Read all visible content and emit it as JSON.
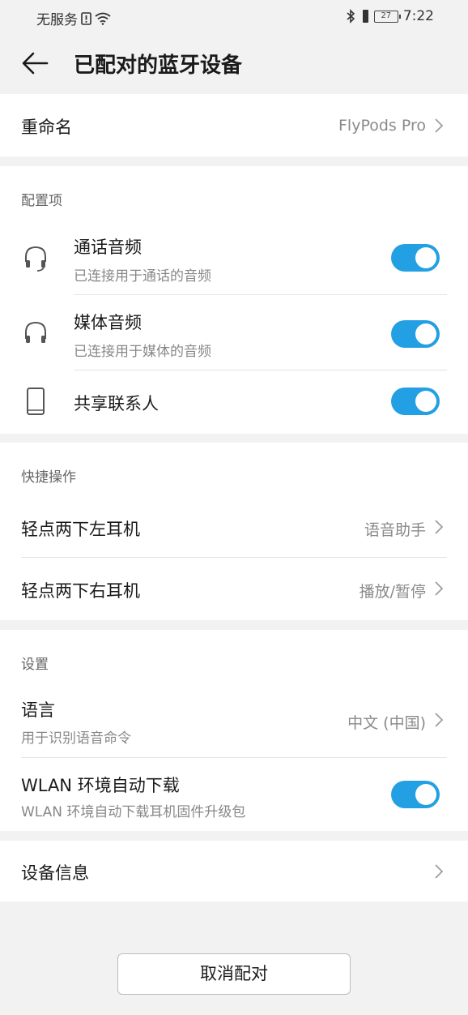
{
  "status_bar": {
    "carrier": "无服务",
    "battery": "27",
    "time": "7:22"
  },
  "header": {
    "title": "已配对的蓝牙设备"
  },
  "rename": {
    "label": "重命名",
    "value": "FlyPods Pro"
  },
  "config": {
    "section_label": "配置项",
    "items": [
      {
        "title": "通话音频",
        "subtitle": "已连接用于通话的音频",
        "enabled": true,
        "icon": "headset-icon"
      },
      {
        "title": "媒体音频",
        "subtitle": "已连接用于媒体的音频",
        "enabled": true,
        "icon": "headphones-icon"
      },
      {
        "title": "共享联系人",
        "enabled": true,
        "icon": "phone-icon"
      }
    ]
  },
  "shortcuts": {
    "section_label": "快捷操作",
    "items": [
      {
        "title": "轻点两下左耳机",
        "value": "语音助手"
      },
      {
        "title": "轻点两下右耳机",
        "value": "播放/暂停"
      }
    ]
  },
  "settings": {
    "section_label": "设置",
    "language": {
      "title": "语言",
      "subtitle": "用于识别语音命令",
      "value": "中文 (中国)"
    },
    "wlan": {
      "title": "WLAN 环境自动下载",
      "subtitle": "WLAN 环境自动下载耳机固件升级包",
      "enabled": true
    }
  },
  "device_info": {
    "label": "设备信息"
  },
  "unpair_button": {
    "label": "取消配对"
  },
  "colors": {
    "accent": "#23a0e3",
    "background": "#f2f2f2",
    "card": "#ffffff"
  }
}
